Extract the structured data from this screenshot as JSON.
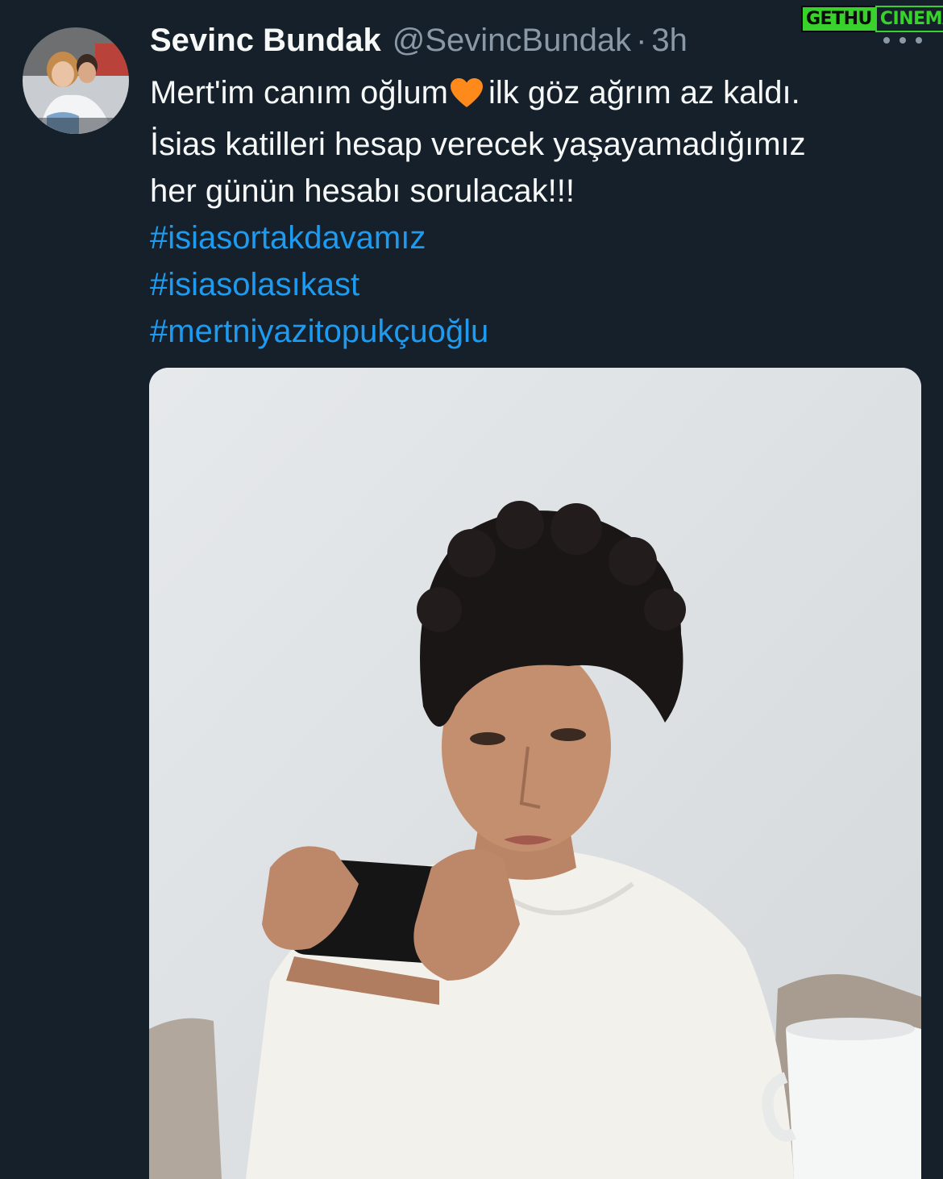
{
  "tweet": {
    "author_name": "Sevinc Bundak",
    "author_handle": "@SevincBundak",
    "separator": "·",
    "time": "3h",
    "text_line1_a": "Mert'im canım oğlum",
    "text_line1_b": "ilk göz ağrım az kaldı.",
    "text_line2": "İsias katilleri hesap verecek yaşayamadığımız",
    "text_line3": "her günün hesabı sorulacak!!!",
    "hashtags": [
      "#isiasortakdavamız",
      "#isiasolasıkast",
      "#mertniyazitopukçuoğlu"
    ],
    "heart_icon": "orange-heart-icon",
    "more_icon": "more-options-icon"
  },
  "watermark": {
    "part1": "GETHU",
    "part2": "CINEMA"
  },
  "colors": {
    "background": "#15202b",
    "text": "#f7f9f9",
    "secondary": "#8b98a5",
    "link": "#1d9bf0",
    "heart": "#ff8a1c",
    "watermark": "#39d12b"
  }
}
